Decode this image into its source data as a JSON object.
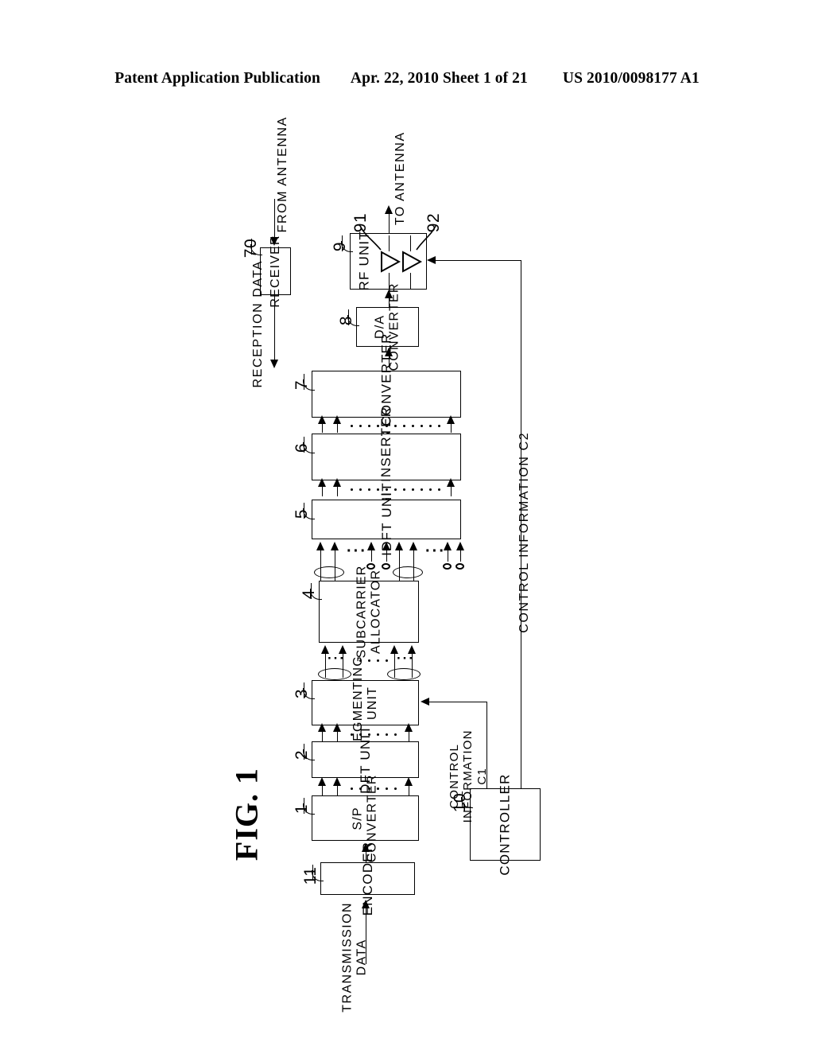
{
  "header": {
    "publication": "Patent Application Publication",
    "date_sheet": "Apr. 22, 2010  Sheet 1 of 21",
    "publication_number": "US 2010/0098177 A1"
  },
  "figure": {
    "label": "FIG. 1"
  },
  "blocks": [
    {
      "id": "receiver",
      "label": "RECEIVER",
      "ref": "70"
    },
    {
      "id": "rf-unit",
      "label": "RF UNIT",
      "ref": "9"
    },
    {
      "id": "da-conv",
      "label": "D/A\nCONVERTER",
      "ref": "8"
    },
    {
      "id": "ps-conv",
      "label": "P/S CONVERTER",
      "ref": "7"
    },
    {
      "id": "gi-ins",
      "label": "GI  INSERTER",
      "ref": "6"
    },
    {
      "id": "idft",
      "label": "IDFT UNIT",
      "ref": "5"
    },
    {
      "id": "subcarrier",
      "label": "SUBCARRIER\nALLOCATOR",
      "ref": "4"
    },
    {
      "id": "segmenting",
      "label": "SEGMENTING\nUNIT",
      "ref": "3"
    },
    {
      "id": "dft",
      "label": "DFT UNIT",
      "ref": "2"
    },
    {
      "id": "sp-conv",
      "label": "S/P\nCONVERTER",
      "ref": "1"
    },
    {
      "id": "encoder",
      "label": "ENCODER",
      "ref": "11"
    },
    {
      "id": "controller",
      "label": "CONTROLLER",
      "ref": "10"
    }
  ],
  "amplifiers": [
    {
      "id": "amp-91",
      "ref": "91"
    },
    {
      "id": "amp-92",
      "ref": "92"
    }
  ],
  "signal_labels": {
    "from_antenna": "FROM ANTENNA",
    "to_antenna": "TO ANTENNA",
    "reception_data": "RECEPTION DATA",
    "transmission_data": "TRANSMISSION\nDATA",
    "control_information_c1": "CONTROL\nINFORMATION\nC1",
    "control_information_c2": "CONTROL INFORMATION C2"
  },
  "colors": {
    "ink": "#000000",
    "paper": "#ffffff"
  }
}
